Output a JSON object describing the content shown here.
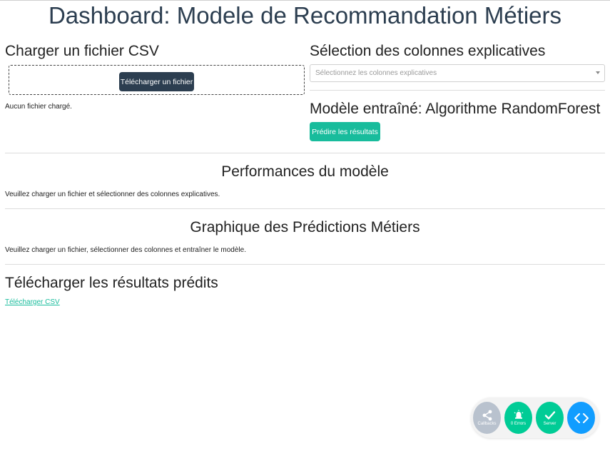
{
  "header": {
    "title": "Dashboard: Modele de Recommandation Métiers"
  },
  "upload": {
    "heading": "Charger un fichier CSV",
    "button_label": "Télécharger un fichier",
    "status": "Aucun fichier chargé."
  },
  "columns": {
    "heading": "Sélection des colonnes explicatives",
    "placeholder": "Sélectionnez les colonnes explicatives"
  },
  "model": {
    "heading": "Modèle entraîné: Algorithme RandomForest",
    "predict_label": "Prédire les résultats"
  },
  "performance": {
    "heading": "Performances du modèle",
    "message": "Veuillez charger un fichier et sélectionner des colonnes explicatives."
  },
  "graph": {
    "heading": "Graphique des Prédictions Métiers",
    "message": "Veuillez charger un fichier, sélectionner des colonnes et entraîner le modèle."
  },
  "download": {
    "heading": "Télécharger les résultats prédits",
    "link_label": "Télécharger CSV"
  },
  "debug_menu": {
    "callbacks_label": "Callbacks",
    "errors_label": "0 Errors",
    "server_label": "Server"
  },
  "colors": {
    "primary": "#2c3e50",
    "accent": "#18bc9c",
    "debug_blue": "#119dff",
    "debug_green": "#00cc96"
  }
}
